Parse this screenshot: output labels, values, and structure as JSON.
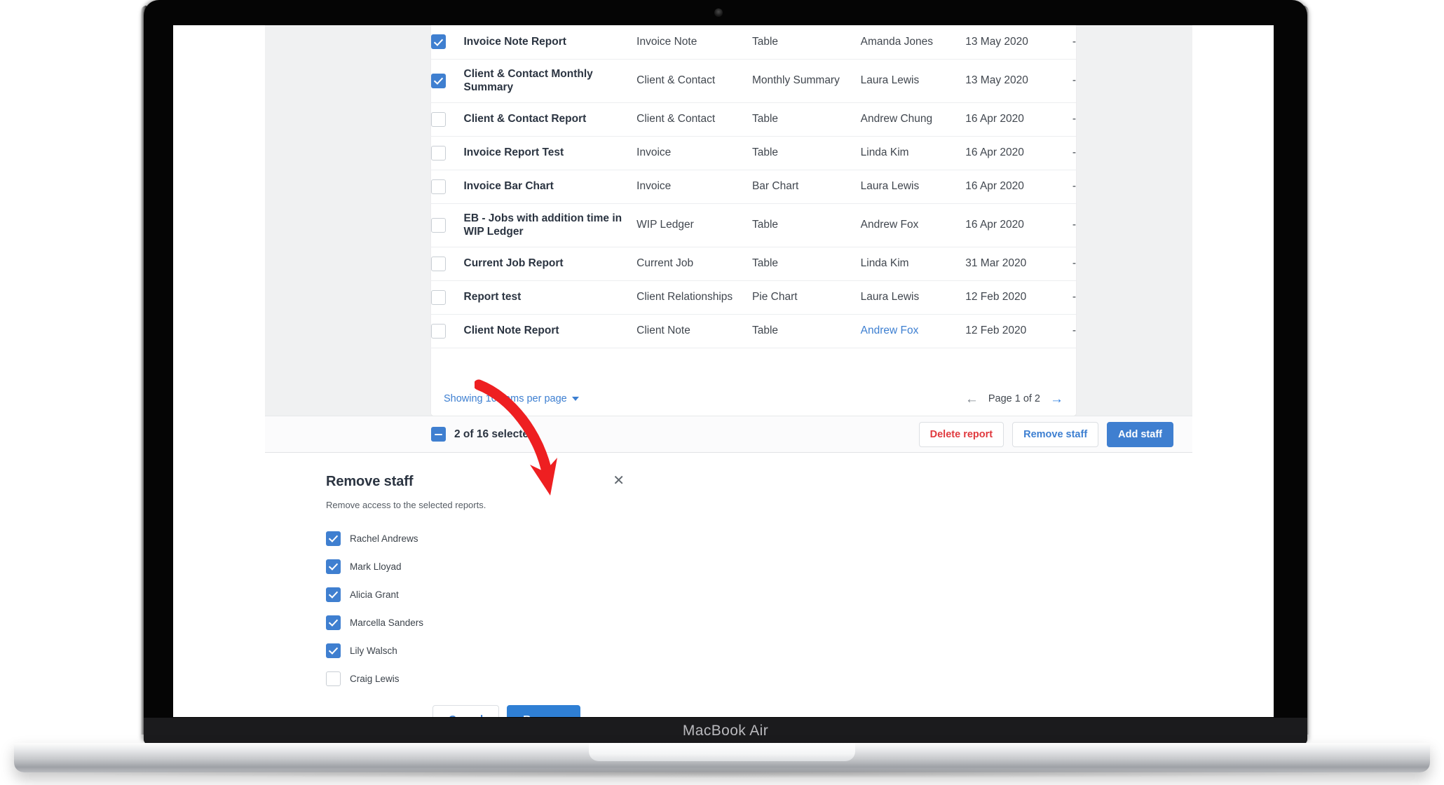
{
  "device": {
    "label": "MacBook Air"
  },
  "table": {
    "rows": [
      {
        "name": "Invoice Note Report",
        "source": "Invoice Note",
        "type": "Table",
        "owner": "Amanda Jones",
        "owner_is_link": false,
        "date": "13 May 2020",
        "trailing": "-",
        "checked": true,
        "tall": false
      },
      {
        "name": "Client & Contact Monthly Summary",
        "source": "Client & Contact",
        "type": "Monthly Summary",
        "owner": "Laura Lewis",
        "owner_is_link": false,
        "date": "13 May 2020",
        "trailing": "-",
        "checked": true,
        "tall": true
      },
      {
        "name": "Client & Contact Report",
        "source": "Client & Contact",
        "type": "Table",
        "owner": "Andrew Chung",
        "owner_is_link": false,
        "date": "16 Apr 2020",
        "trailing": "-",
        "checked": false,
        "tall": false
      },
      {
        "name": "Invoice Report Test",
        "source": "Invoice",
        "type": "Table",
        "owner": "Linda Kim",
        "owner_is_link": false,
        "date": "16 Apr 2020",
        "trailing": "-",
        "checked": false,
        "tall": false
      },
      {
        "name": "Invoice Bar Chart",
        "source": "Invoice",
        "type": "Bar Chart",
        "owner": "Laura Lewis",
        "owner_is_link": false,
        "date": "16 Apr 2020",
        "trailing": "-",
        "checked": false,
        "tall": false
      },
      {
        "name": "EB - Jobs with addition time in WIP Ledger",
        "source": "WIP Ledger",
        "type": "Table",
        "owner": "Andrew Fox",
        "owner_is_link": false,
        "date": "16 Apr 2020",
        "trailing": "-",
        "checked": false,
        "tall": true
      },
      {
        "name": "Current Job Report",
        "source": "Current Job",
        "type": "Table",
        "owner": "Linda Kim",
        "owner_is_link": false,
        "date": "31 Mar 2020",
        "trailing": "-",
        "checked": false,
        "tall": false
      },
      {
        "name": "Report test",
        "source": "Client Relationships",
        "type": "Pie Chart",
        "owner": "Laura Lewis",
        "owner_is_link": false,
        "date": "12 Feb 2020",
        "trailing": "-",
        "checked": false,
        "tall": false
      },
      {
        "name": "Client Note Report",
        "source": "Client Note",
        "type": "Table",
        "owner": "Andrew Fox",
        "owner_is_link": true,
        "date": "12 Feb 2020",
        "trailing": "-",
        "checked": false,
        "tall": false
      }
    ],
    "footer": {
      "per_page_label": "Showing 10 items per page",
      "page_label": "Page 1 of 2",
      "prev_icon": "arrow-left-icon",
      "next_icon": "arrow-right-icon"
    }
  },
  "action_bar": {
    "selection_label": "2 of 16 selected",
    "delete_label": "Delete report",
    "remove_staff_label": "Remove staff",
    "add_staff_label": "Add staff"
  },
  "modal": {
    "title": "Remove staff",
    "subtitle": "Remove access to the selected reports.",
    "close_icon": "close-icon",
    "staff": [
      {
        "name": "Rachel Andrews",
        "checked": true
      },
      {
        "name": "Mark Lloyad",
        "checked": true
      },
      {
        "name": "Alicia Grant",
        "checked": true
      },
      {
        "name": "Marcella Sanders",
        "checked": true
      },
      {
        "name": "Lily Walsch",
        "checked": true
      },
      {
        "name": "Craig Lewis",
        "checked": false
      }
    ],
    "cancel_label": "Cancel",
    "confirm_label": "Remove"
  },
  "colors": {
    "accent_blue": "#3f7fd0",
    "link_blue": "#3d7fd1",
    "danger_red": "#e0393e",
    "annotation_red": "#ee1f21",
    "app_bg": "#f0f1f2"
  }
}
